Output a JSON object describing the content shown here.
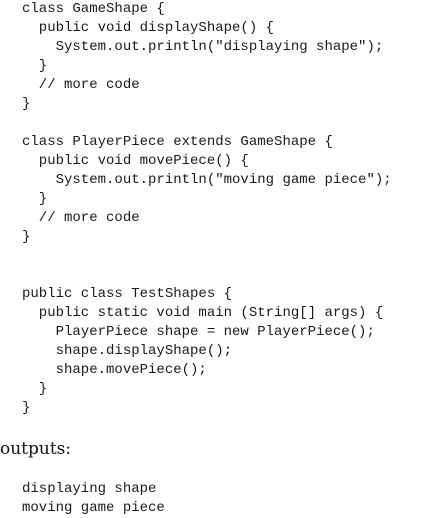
{
  "code": {
    "lines": [
      "class GameShape {",
      "  public void displayShape() {",
      "    System.out.println(\"displaying shape\");",
      "  }",
      "  // more code",
      "}",
      "",
      "class PlayerPiece extends GameShape {",
      "  public void movePiece() {",
      "    System.out.println(\"moving game piece\");",
      "  }",
      "  // more code",
      "}",
      "",
      "",
      "public class TestShapes {",
      "  public static void main (String[] args) {",
      "    PlayerPiece shape = new PlayerPiece();",
      "    shape.displayShape();",
      "    shape.movePiece();",
      "  }",
      "}"
    ]
  },
  "caption": "outputs:",
  "output": {
    "lines": [
      "displaying shape",
      "moving game piece"
    ]
  }
}
